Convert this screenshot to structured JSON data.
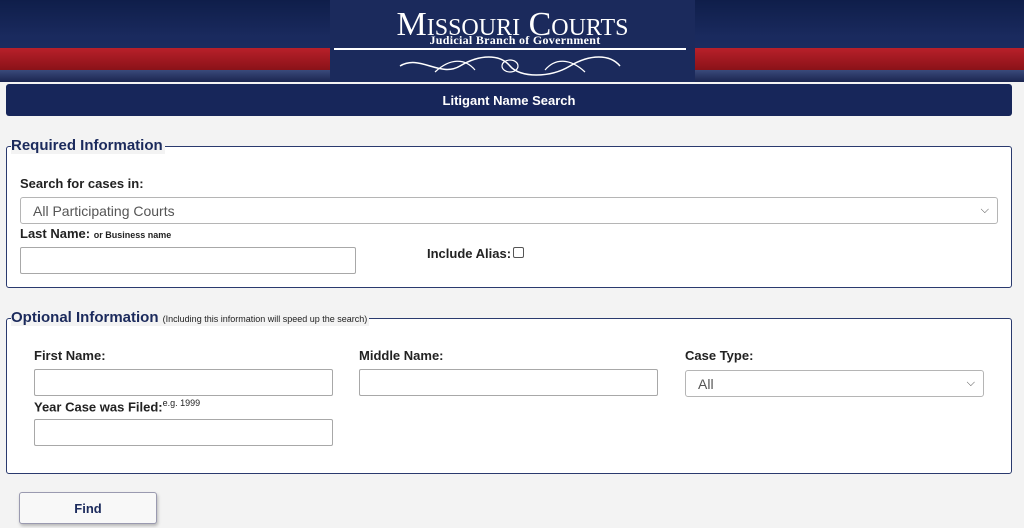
{
  "header": {
    "logo_title": "Missouri Courts",
    "logo_subtitle": "Judicial Branch of Government",
    "page_title": "Litigant Name Search"
  },
  "required": {
    "legend": "Required Information",
    "search_in_label": "Search for cases in:",
    "search_in_value": "All Participating Courts",
    "last_name_label": "Last Name:",
    "last_name_hint": "or Business name",
    "last_name_value": "",
    "include_alias_label": "Include Alias:",
    "include_alias_checked": false
  },
  "optional": {
    "legend": "Optional Information",
    "legend_hint": "(Including this information will speed up the search)",
    "first_name_label": "First Name:",
    "middle_name_label": "Middle Name:",
    "case_type_label": "Case Type:",
    "case_type_value": "All",
    "year_filed_label": "Year Case was Filed:",
    "year_filed_hint": "e.g. 1999"
  },
  "actions": {
    "find_label": "Find"
  },
  "colors": {
    "navy": "#17265a",
    "red_stripe": "#b8202a",
    "border": "#2a3a6e"
  }
}
